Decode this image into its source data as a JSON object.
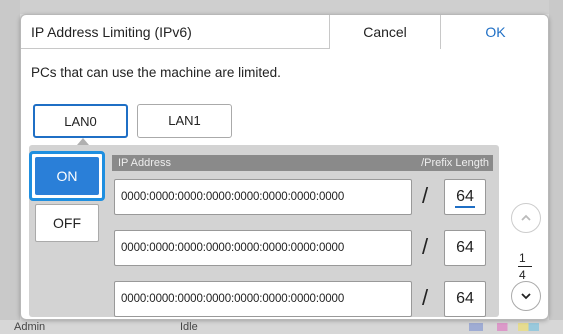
{
  "background": {
    "status_user": "Admin",
    "status_state": "Idle"
  },
  "dialog": {
    "title": "IP Address Limiting (IPv6)",
    "cancel_label": "Cancel",
    "ok_label": "OK",
    "description": "PCs that can use the machine are limited."
  },
  "lan_tabs": [
    {
      "label": "LAN0",
      "selected": true
    },
    {
      "label": "LAN1",
      "selected": false
    }
  ],
  "toggle": {
    "on_label": "ON",
    "off_label": "OFF",
    "selected": "ON"
  },
  "table": {
    "col_ip": "IP Address",
    "col_prefix": "/Prefix Length",
    "rows": [
      {
        "ip": "0000:0000:0000:0000:0000:0000:0000:0000",
        "separator": "/",
        "prefix": "64"
      },
      {
        "ip": "0000:0000:0000:0000:0000:0000:0000:0000",
        "separator": "/",
        "prefix": "64"
      },
      {
        "ip": "0000:0000:0000:0000:0000:0000:0000:0000",
        "separator": "/",
        "prefix": "64"
      }
    ]
  },
  "pager": {
    "current": "1",
    "total": "4",
    "up_icon": "chevron-up-icon",
    "down_icon": "chevron-down-icon"
  },
  "colors": {
    "accent": "#1f6fc5",
    "on_fill": "#2a7fd8",
    "focus_ring": "#1f8fe0"
  }
}
